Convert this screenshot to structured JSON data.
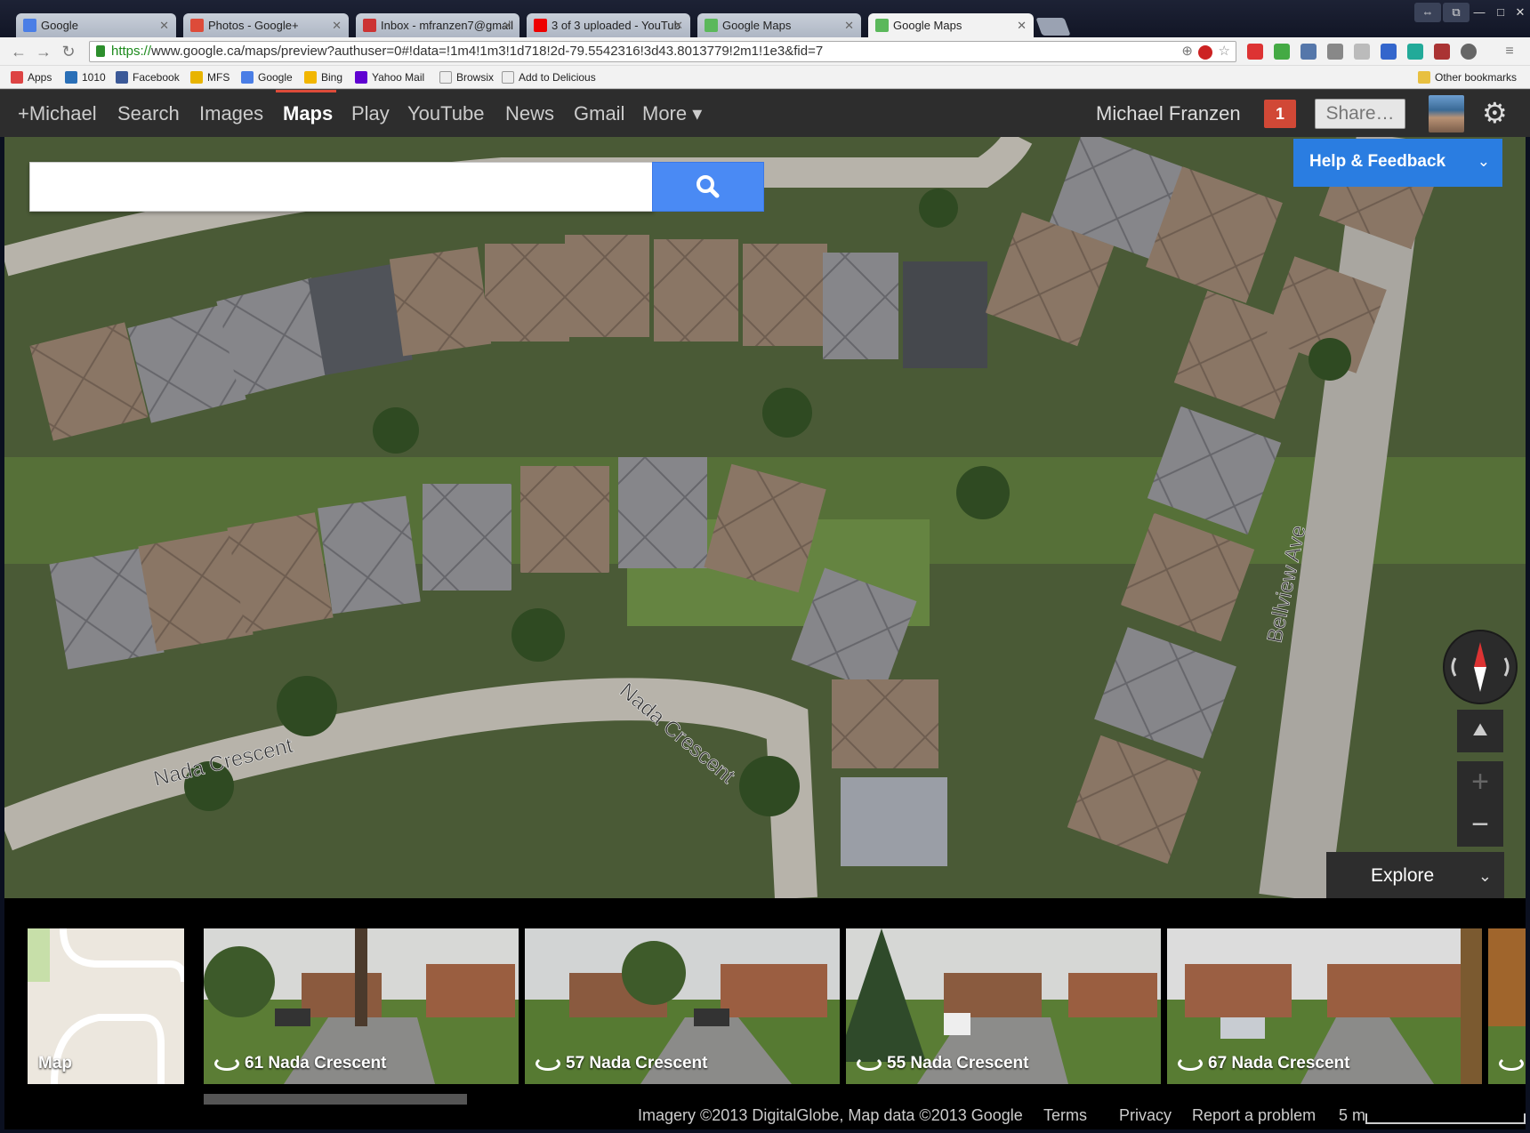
{
  "tabs": [
    {
      "label": "Google",
      "icon": "google-favicon",
      "color": "#4a7ee6"
    },
    {
      "label": "Photos - Google+",
      "icon": "google-plus-favicon",
      "color": "#dd4b39"
    },
    {
      "label": "Inbox - mfranzen7@gmail",
      "icon": "gmail-favicon",
      "color": "#c33"
    },
    {
      "label": "3 of 3 uploaded - YouTub",
      "icon": "youtube-favicon",
      "color": "#e00"
    },
    {
      "label": "Google Maps",
      "icon": "maps-favicon",
      "color": "#5bb85b"
    },
    {
      "label": "Google Maps",
      "icon": "maps-favicon",
      "color": "#5bb85b"
    }
  ],
  "address": {
    "scheme": "https://",
    "rest": "www.google.ca/maps/preview?authuser=0#!data=!1m4!1m3!1d718!2d-79.5542316!3d43.8013779!2m1!1e3&fid=7"
  },
  "bookmarks": [
    {
      "label": "Apps"
    },
    {
      "label": "1010"
    },
    {
      "label": "Facebook"
    },
    {
      "label": "MFS"
    },
    {
      "label": "Google"
    },
    {
      "label": "Bing"
    },
    {
      "label": "Yahoo Mail"
    },
    {
      "label": "Browsix"
    },
    {
      "label": "Add to Delicious"
    },
    {
      "label": "Other bookmarks"
    }
  ],
  "gbar": {
    "items": [
      "+Michael",
      "Search",
      "Images",
      "Maps",
      "Play",
      "YouTube",
      "News",
      "Gmail",
      "More ▾"
    ],
    "user": "Michael Franzen",
    "notifications": "1",
    "share": "Share…"
  },
  "map": {
    "search_placeholder": "",
    "help": "Help & Feedback",
    "explore": "Explore",
    "street_labels": [
      "Nada Crescent",
      "Nada Crescent",
      "Bellview Ave"
    ]
  },
  "strip": {
    "map_label": "Map",
    "thumbs": [
      "61 Nada Crescent",
      "57 Nada Crescent",
      "55 Nada Crescent",
      "67 Nada Crescent"
    ]
  },
  "footer": {
    "attribution": "Imagery ©2013 DigitalGlobe, Map data ©2013 Google",
    "terms": "Terms",
    "privacy": "Privacy",
    "report": "Report a problem",
    "scale": "5 m"
  }
}
